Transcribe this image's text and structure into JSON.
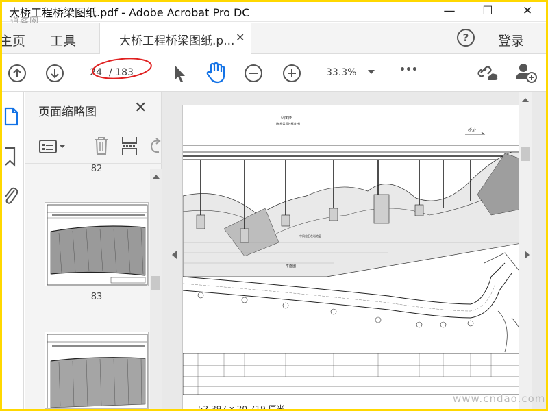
{
  "window": {
    "title": "大桥工程桥梁图纸.pdf - Adobe Acrobat Pro DC",
    "watermark": "道客网",
    "minimize_glyph": "—",
    "maximize_glyph": "☐",
    "close_glyph": "✕"
  },
  "menubar": {
    "home_label": "主页",
    "tools_label": "工具",
    "doc_tab_label": "大桥工程桥梁图纸.p...",
    "doc_tab_close": "✕",
    "help_glyph": "?",
    "signin_label": "登录"
  },
  "toolbar": {
    "page_current": "24",
    "page_total": "/ 183",
    "zoom_value": "33.3%",
    "more_glyph": "•••",
    "icons": [
      "prev-page-icon",
      "next-page-icon",
      "select-tool-icon",
      "hand-tool-icon",
      "zoom-out-icon",
      "zoom-in-icon",
      "more-tools-icon",
      "share-link-icon",
      "add-user-icon"
    ],
    "annotation_color": "#e02020",
    "accent_color": "#1473e6"
  },
  "leftstrip": {
    "icons": [
      "page-thumbnails-icon",
      "bookmark-icon",
      "attachment-icon"
    ]
  },
  "thumbnails_pane": {
    "title": "页面缩略图",
    "close_glyph": "✕",
    "icons": [
      "thumbnail-options-icon",
      "delete-page-icon",
      "insert-page-icon",
      "rotate-page-icon"
    ],
    "page_above": "82",
    "thumbnails": [
      {
        "page": "83"
      },
      {
        "page": ""
      }
    ]
  },
  "document": {
    "status_coords": "52.397 x 20.719 厘米",
    "site_watermark": "www.cndao.com",
    "drawing": {
      "elevation_title": "立面图",
      "elevation_subtitle": "(按桥梁设计标准计)",
      "plan_title": "平面图",
      "direction_label": "桥址",
      "legend_note": "中风化石灰岩地层"
    }
  }
}
